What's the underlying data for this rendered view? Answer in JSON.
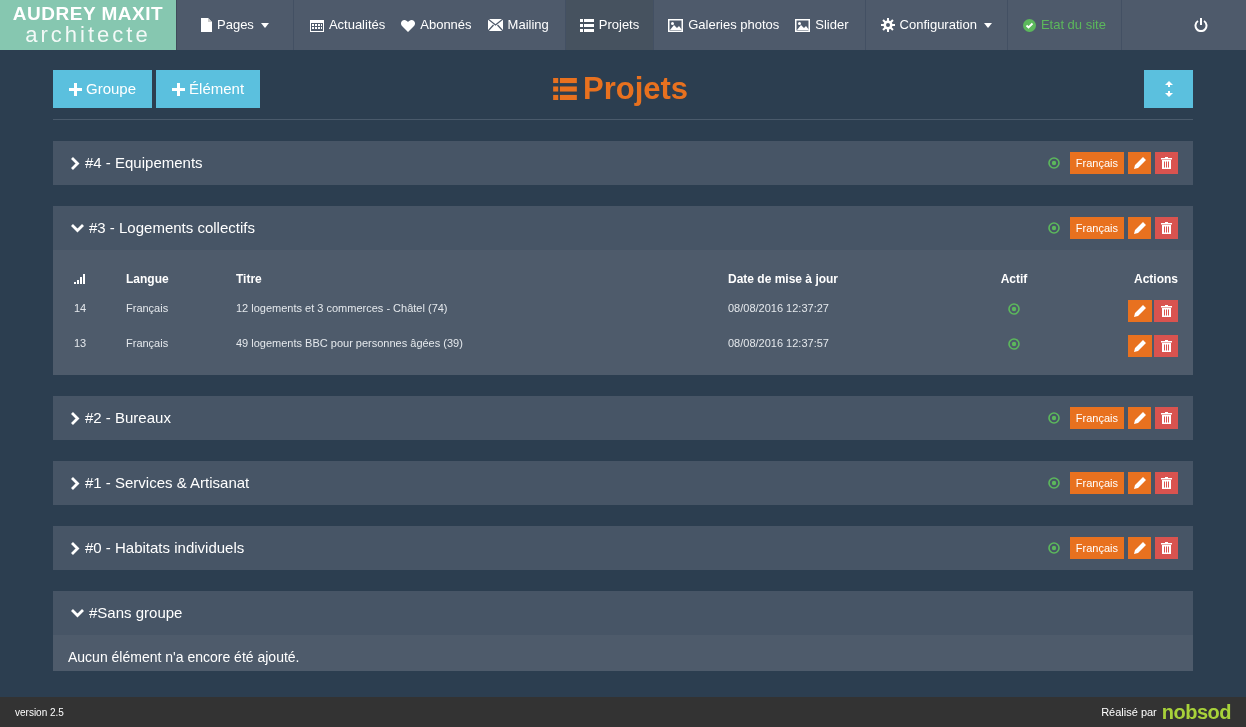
{
  "logo": {
    "name": "AUDREY MAXIT",
    "subtitle": "architecte"
  },
  "nav": [
    {
      "label": "Pages",
      "dropdown": true,
      "selected": false,
      "kind": "link"
    },
    {
      "label": "Actualités",
      "dropdown": false,
      "selected": false,
      "kind": "link"
    },
    {
      "label": "Abonnés",
      "dropdown": false,
      "selected": false,
      "kind": "link"
    },
    {
      "label": "Mailing",
      "dropdown": false,
      "selected": false,
      "kind": "link"
    },
    {
      "label": "Projets",
      "dropdown": false,
      "selected": true,
      "kind": "link"
    },
    {
      "label": "Galeries photos",
      "dropdown": false,
      "selected": false,
      "kind": "link"
    },
    {
      "label": "Slider",
      "dropdown": false,
      "selected": false,
      "kind": "link"
    },
    {
      "label": "Configuration",
      "dropdown": true,
      "selected": false,
      "kind": "link"
    },
    {
      "label": "Etat du site",
      "dropdown": false,
      "selected": false,
      "kind": "status"
    }
  ],
  "toolbar": {
    "buttons": [
      "Groupe",
      "Élément"
    ],
    "title": "Projets"
  },
  "groups": [
    {
      "title": "#4 - Equipements",
      "expanded": false,
      "active": true,
      "language": "Français"
    },
    {
      "title": "#3 - Logements collectifs",
      "expanded": true,
      "active": true,
      "language": "Français",
      "table": {
        "columns": [
          "Langue",
          "Titre",
          "Date de mise à jour",
          "Actif",
          "Actions"
        ],
        "rows": [
          {
            "order": "14",
            "language": "Français",
            "title": "12 logements et 3 commerces - Châtel (74)",
            "updated": "08/08/2016 12:37:27",
            "active": true
          },
          {
            "order": "13",
            "language": "Français",
            "title": "49 logements BBC pour personnes âgées (39)",
            "updated": "08/08/2016 12:37:57",
            "active": true
          }
        ]
      }
    },
    {
      "title": "#2 - Bureaux",
      "expanded": false,
      "active": true,
      "language": "Français"
    },
    {
      "title": "#1 - Services & Artisanat",
      "expanded": false,
      "active": true,
      "language": "Français"
    },
    {
      "title": "#0 - Habitats individuels",
      "expanded": false,
      "active": true,
      "language": "Français"
    },
    {
      "title": "#Sans groupe",
      "expanded": true,
      "empty_message": "Aucun élément n'a encore été ajouté."
    }
  ],
  "footer": {
    "version": "version 2.5",
    "credit": "Réalisé par",
    "brand": "nobsod"
  }
}
